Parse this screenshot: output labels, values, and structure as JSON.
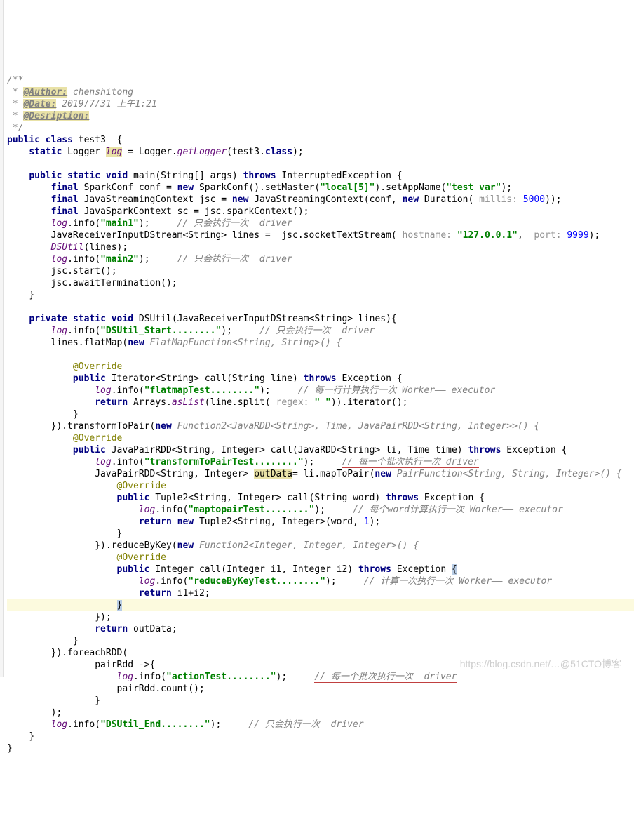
{
  "docblock": {
    "open": "/**",
    "author_tag": "@Author:",
    "author_val": " chenshitong",
    "date_tag": "@Date:",
    "date_val": " 2019/7/31 上午1:21",
    "desc_tag": "@Desription:",
    "close": " */"
  },
  "c": {
    "public": "public",
    "class": "class",
    "cname": "test3",
    "lb": "{",
    "rb": "}",
    "static": "static",
    "Logger": "Logger",
    "log": "log",
    "eq": " = Logger.",
    "getLogger": "getLogger",
    "t3class": "(test3.",
    "classkw": "class",
    "endp": ");",
    "void": "void",
    "main": "main",
    "mainargs": "(String[] args) ",
    "throws": "throws",
    "IE": " InterruptedException {",
    "final": "final",
    "sc1": " SparkConf conf = ",
    "new": "new",
    "sc2": " SparkConf().setMaster(",
    "local5": "\"local[5]\"",
    "sc3": ").setAppName(",
    "testvar": "\"test var\"",
    "sc4": ");",
    "jsc1": " JavaStreamingContext jsc = ",
    "jsc2": " JavaStreamingContext(conf, ",
    "jsc3": " Duration( ",
    "millis": "millis: ",
    "five": "5000",
    "jsc4": "));",
    "spc1": " JavaSparkContext sc = jsc.sparkContext();",
    "loginfo": ".info(",
    "main1": "\"main1\"",
    "logend": ");     ",
    "c1": "// 只会执行一次  driver",
    "line1a": "JavaReceiverInputDStream<String> lines =  jsc.socketTextStream( ",
    "hostname": "hostname: ",
    "ip": "\"127.0.0.1\"",
    "comma": ",  ",
    "port": "port: ",
    "pnum": "9999",
    "line1b": ");",
    "dsu": "DSUtil",
    "dsu2": "(lines);",
    "main2": "\"main2\"",
    "jscstart": "jsc.start();",
    "jscawait": "jsc.awaitTermination();",
    "private": "private",
    "dsutil_sig": " DSUtil(JavaReceiverInputDStream<String> lines){",
    "dsstart": "\"DSUtil_Start........\"",
    "flat1": "lines.flatMap(",
    "flat2": " FlatMapFunction<String, String>() {",
    "override": "@Override",
    "it1": " Iterator<String> call(String line) ",
    "exc": " Exception {",
    "flatmaptest": "\"flatmapTest........\"",
    "c2": "// 每一行计算执行一次 Worker—— executor",
    "return": "return",
    "arr1": " Arrays.",
    "aslist": "asList",
    "arr2": "(line.split( ",
    "regex": "regex: ",
    "space": "\" \"",
    "arr3": ")).iterator();",
    "ttp1": "}).transformToPair(",
    "ttp2": " Function2<JavaRDD<String>, Time, JavaPairRDD<String, Integer>>() {",
    "jp1": " JavaPairRDD<String, Integer> call(JavaRDD<String> li, Time time) ",
    "ttptest": "\"transformToPairTest........\"",
    "c3": "// 每一个批次执行一次 driver",
    "od1": "JavaPairRDD<String, Integer> ",
    "outdata": "outData",
    "od2": "= li.mapToPair(",
    "od3": " PairFunction<String, String, Integer>() {",
    "tp1": " Tuple2<String, Integer> call(String word) ",
    "mtptest": "\"maptopairTest........\"",
    "c4": "// 每个word计算执行一次 Worker—— executor",
    "rtn1": " Tuple2<String, Integer>(word, ",
    "one": "1",
    "rtn2": ");",
    "rbk1": "}).reduceByKey(",
    "rbk2": " Function2<Integer, Integer, Integer>() {",
    "int1": " Integer call(Integer i1, Integer i2) ",
    "rbktest": "\"reduceByKeyTest........\"",
    "c5": "// 计算一次执行一次 Worker—— executor",
    "rtni": " i1+i2;",
    "cl1": "});",
    "rout": " outData;",
    "fe1": "}).foreachRDD(",
    "fe2": "pairRdd ->{",
    "actest": "\"actionTest........\"",
    "c6": "// 每一个批次执行一次  driver",
    "prc": "pairRdd.count();",
    "cl2": ");",
    "dsend": "\"DSUtil_End........\""
  },
  "watermark": "https://blog.csdn.net/…@51CTO博客"
}
